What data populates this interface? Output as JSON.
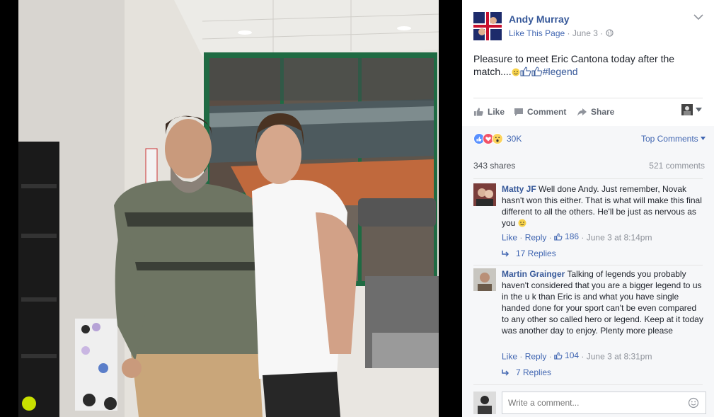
{
  "post": {
    "author": "Andy Murray",
    "like_page": "Like This Page",
    "separator": "·",
    "date": "June 3",
    "text_main": "Pleasure to meet Eric Cantona today after the match....",
    "hashtag": "#legend"
  },
  "actions": {
    "like": "Like",
    "comment": "Comment",
    "share": "Share"
  },
  "reactions": {
    "count": "30K",
    "sort_label": "Top Comments",
    "types": [
      "like-icon",
      "love-icon",
      "wow-icon"
    ]
  },
  "stats": {
    "shares": "343 shares",
    "comments": "521 comments"
  },
  "comments": [
    {
      "name": "Matty JF",
      "text": "Well done Andy. Just remember, Novak hasn't won this either. That is what will make this final different to all the others. He'll be just as nervous as you",
      "like": "Like",
      "reply": "Reply",
      "likes": "186",
      "time": "June 3 at 8:14pm",
      "replies": "17 Replies"
    },
    {
      "name": "Martin Grainger",
      "text": "Talking of legends you probably haven't considered that you are a bigger legend to us in the u k than Eric is and what you have single handed done for your sport can't be even compared to any other so called hero or legend. Keep at it today was another day to enjoy. Plenty more please",
      "like": "Like",
      "reply": "Reply",
      "likes": "104",
      "time": "June 3 at 8:31pm",
      "replies": "7 Replies"
    }
  ],
  "composer": {
    "placeholder": "Write a comment..."
  },
  "colors": {
    "link": "#365899",
    "accent": "#4267b2",
    "muted": "#90949c",
    "like_blue": "#5890ff",
    "love_red": "#f25268",
    "wow_yellow": "#fcd35b"
  }
}
